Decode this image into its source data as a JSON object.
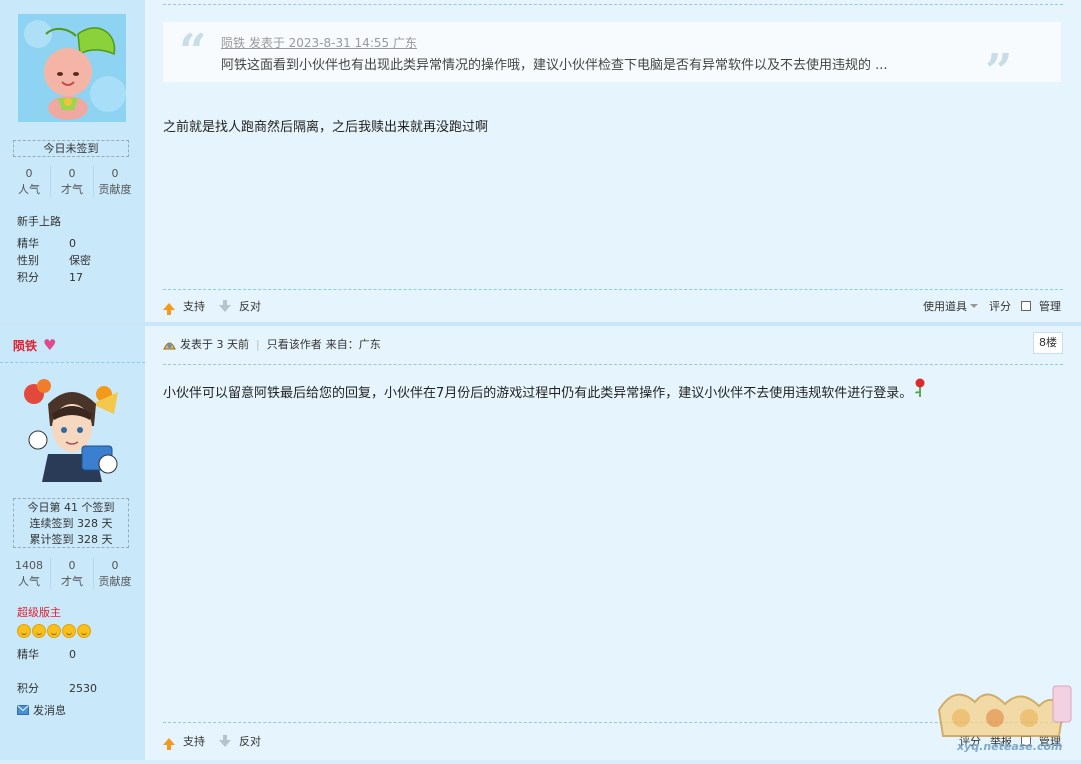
{
  "post1": {
    "sign_status": "今日未签到",
    "stats": [
      {
        "num": "0",
        "label": "人气"
      },
      {
        "num": "0",
        "label": "才气"
      },
      {
        "num": "0",
        "label": "贡献度"
      }
    ],
    "rank": "新手上路",
    "info": [
      {
        "k": "精华",
        "v": "0"
      },
      {
        "k": "性别",
        "v": "保密"
      },
      {
        "k": "积分",
        "v": "17"
      }
    ],
    "quote_meta": "陨铁 发表于 2023-8-31 14:55 广东",
    "quote_text": "阿铁这面看到小伙伴也有出现此类异常情况的操作哦，建议小伙伴检查下电脑是否有异常软件以及不去使用违规的 ...",
    "body": "之前就是找人跑商然后隔离，之后我赎出来就再没跑过啊",
    "support_label": "支持",
    "oppose_label": "反对",
    "use_tool_label": "使用道具",
    "rate_label": "评分",
    "manage_label": "管理"
  },
  "post2": {
    "username": "陨铁",
    "sign_lines": [
      "今日第 41 个签到",
      "连续签到 328 天",
      "累计签到 328 天"
    ],
    "stats": [
      {
        "num": "1408",
        "label": "人气"
      },
      {
        "num": "0",
        "label": "才气"
      },
      {
        "num": "0",
        "label": "贡献度"
      }
    ],
    "rank": "超级版主",
    "info": [
      {
        "k": "精华",
        "v": "0"
      },
      {
        "k": "积分",
        "v": "2530"
      }
    ],
    "message_label": "发消息",
    "meta_posted": "发表于 3 天前",
    "meta_only_author": "只看该作者",
    "meta_from": "来自：广东",
    "floor": "8楼",
    "body": "小伙伴可以留意阿铁最后给您的回复，小伙伴在7月份后的游戏过程中仍有此类异常操作，建议小伙伴不去使用违规软件进行登录。",
    "support_label": "支持",
    "oppose_label": "反对",
    "rate_label": "评分",
    "report_label": "举报",
    "manage_label": "管理"
  },
  "watermark": {
    "text": "xyq.netease.com"
  }
}
